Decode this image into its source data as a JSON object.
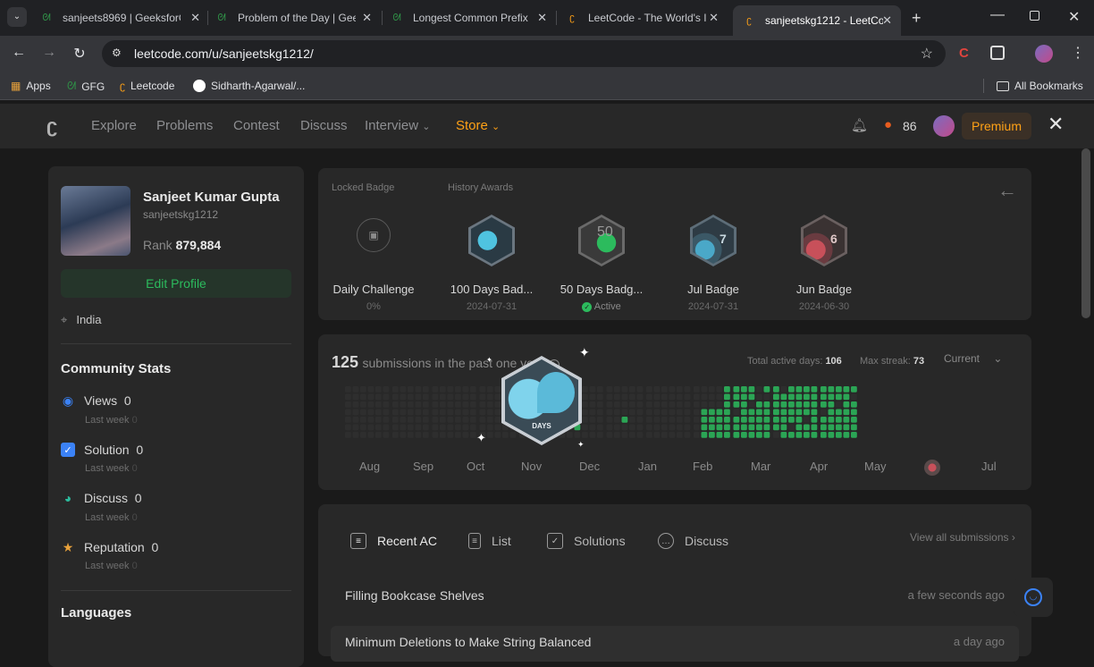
{
  "browser": {
    "tabs": [
      {
        "title": "sanjeets8969 | GeeksforG",
        "favicon": "gfg-icon"
      },
      {
        "title": "Problem of the Day | Gee",
        "favicon": "gfg-icon"
      },
      {
        "title": "Longest Common Prefix",
        "favicon": "gfg-icon"
      },
      {
        "title": "LeetCode - The World's I",
        "favicon": "leetcode-icon"
      },
      {
        "title": "sanjeetskg1212 - LeetCo",
        "favicon": "leetcode-icon"
      }
    ],
    "url": "leetcode.com/u/sanjeetskg1212/",
    "bookmarks": [
      "Apps",
      "GFG",
      "Leetcode",
      "Sidharth-Agarwal/..."
    ],
    "all_bookmarks": "All Bookmarks"
  },
  "nav": {
    "items": [
      "Explore",
      "Problems",
      "Contest",
      "Discuss",
      "Interview",
      "Store"
    ],
    "streak": "86",
    "premium": "Premium"
  },
  "profile": {
    "name": "Sanjeet Kumar Gupta",
    "username": "sanjeetskg1212",
    "rank_label": "Rank",
    "rank": "879,884",
    "edit": "Edit Profile",
    "location": "India"
  },
  "community": {
    "title": "Community Stats",
    "stats": [
      {
        "label": "Views",
        "value": "0",
        "sub": "Last week",
        "subval": "0"
      },
      {
        "label": "Solution",
        "value": "0",
        "sub": "Last week",
        "subval": "0"
      },
      {
        "label": "Discuss",
        "value": "0",
        "sub": "Last week",
        "subval": "0"
      },
      {
        "label": "Reputation",
        "value": "0",
        "sub": "Last week",
        "subval": "0"
      }
    ],
    "languages": "Languages"
  },
  "badges": {
    "locked_label": "Locked Badge",
    "history_label": "History Awards",
    "items": [
      {
        "name": "Daily Challenge",
        "date": "0%"
      },
      {
        "name": "100 Days Bad...",
        "date": "2024-07-31"
      },
      {
        "name": "50 Days Badg...",
        "date": "Active"
      },
      {
        "name": "Jul Badge",
        "date": "2024-07-31"
      },
      {
        "name": "Jun Badge",
        "date": "2024-06-30"
      }
    ],
    "hex_text": [
      "",
      "DAYS",
      "50",
      "7",
      "6"
    ]
  },
  "calendar": {
    "count": "125",
    "text": "submissions in the past one year",
    "active_label": "Total active days:",
    "active": "106",
    "streak_label": "Max streak:",
    "streak": "73",
    "range": "Current",
    "months": [
      "Aug",
      "Sep",
      "Oct",
      "Nov",
      "Dec",
      "Jan",
      "Feb",
      "Mar",
      "Apr",
      "May",
      "Jul"
    ],
    "overlay_text": "DAYS"
  },
  "recent": {
    "tabs": [
      "Recent AC",
      "List",
      "Solutions",
      "Discuss"
    ],
    "view_all": "View all submissions",
    "rows": [
      {
        "title": "Filling Bookcase Shelves",
        "time": "a few seconds ago"
      },
      {
        "title": "Minimum Deletions to Make String Balanced",
        "time": "a day ago"
      }
    ]
  },
  "colors": {
    "green": "#2cbb5d",
    "accent": "#ffa116",
    "cell_empty": "#333333"
  }
}
